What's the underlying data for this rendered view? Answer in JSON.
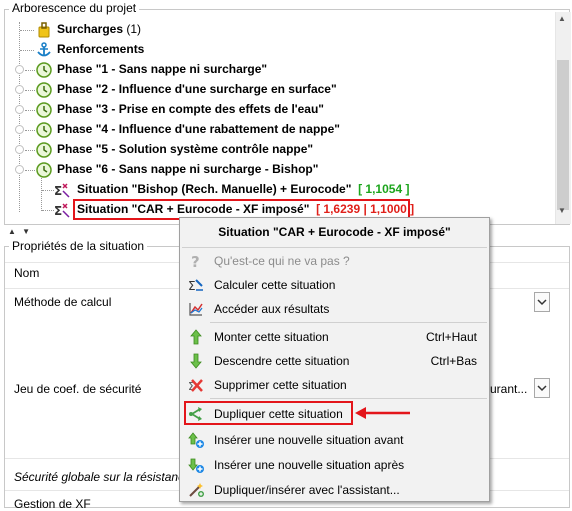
{
  "tree": {
    "group_title": "Arborescence du projet",
    "items": [
      {
        "label": "Surcharges",
        "suffix": " (1)"
      },
      {
        "label": "Renforcements"
      },
      {
        "label": "Phase \"1 - Sans nappe ni surcharge\""
      },
      {
        "label": "Phase \"2 - Influence d'une surcharge en surface\""
      },
      {
        "label": "Phase \"3 - Prise en compte des effets de l'eau\""
      },
      {
        "label": "Phase \"4 - Influence d'une rabattement de nappe\""
      },
      {
        "label": "Phase \"5 - Solution système contrôle nappe\""
      },
      {
        "label": "Phase \"6 - Sans nappe ni surcharge - Bishop\""
      }
    ],
    "situations": [
      {
        "label": "Situation \"Bishop (Rech. Manuelle) + Eurocode\"",
        "value": "[ 1,1054 ]",
        "value_color": "#1ca51c"
      },
      {
        "label": "Situation \"CAR + Eurocode - XF imposé\"",
        "value": "[ 1,6239 | 1,1000 ]",
        "value_color": "#e0201a"
      }
    ]
  },
  "splitter": {
    "arrows": "▲ ▼"
  },
  "properties": {
    "group_title": "Propriétés de la situation",
    "rows": [
      {
        "label": "Nom"
      },
      {
        "label": "Méthode de calcul"
      },
      {
        "label": "Jeu de coef. de sécurité",
        "value_partial": "urant..."
      },
      {
        "label": "Sécurité globale sur la résistance"
      },
      {
        "label": "Gestion de XF"
      }
    ]
  },
  "context_menu": {
    "title": "Situation \"CAR + Eurocode - XF imposé\"",
    "items": [
      {
        "label": "Qu'est-ce qui ne va pas ?",
        "icon": "question-icon",
        "disabled": true
      },
      {
        "label": "Calculer cette situation",
        "icon": "calculate-icon"
      },
      {
        "label": "Accéder aux résultats",
        "icon": "results-chart-icon"
      },
      {
        "label": "Monter cette situation",
        "icon": "arrow-up-icon",
        "shortcut": "Ctrl+Haut"
      },
      {
        "label": "Descendre cette situation",
        "icon": "arrow-down-icon",
        "shortcut": "Ctrl+Bas"
      },
      {
        "label": "Supprimer cette situation",
        "icon": "delete-icon"
      },
      {
        "label": "Dupliquer cette situation",
        "icon": "duplicate-icon"
      },
      {
        "label": "Insérer une nouvelle situation avant",
        "icon": "insert-before-icon"
      },
      {
        "label": "Insérer une nouvelle situation après",
        "icon": "insert-after-icon"
      },
      {
        "label": "Dupliquer/insérer avec l'assistant...",
        "icon": "wizard-icon"
      }
    ]
  },
  "colors": {
    "highlight_red": "#e3151a",
    "green_value": "#1ca51c",
    "red_value": "#e0201a"
  }
}
